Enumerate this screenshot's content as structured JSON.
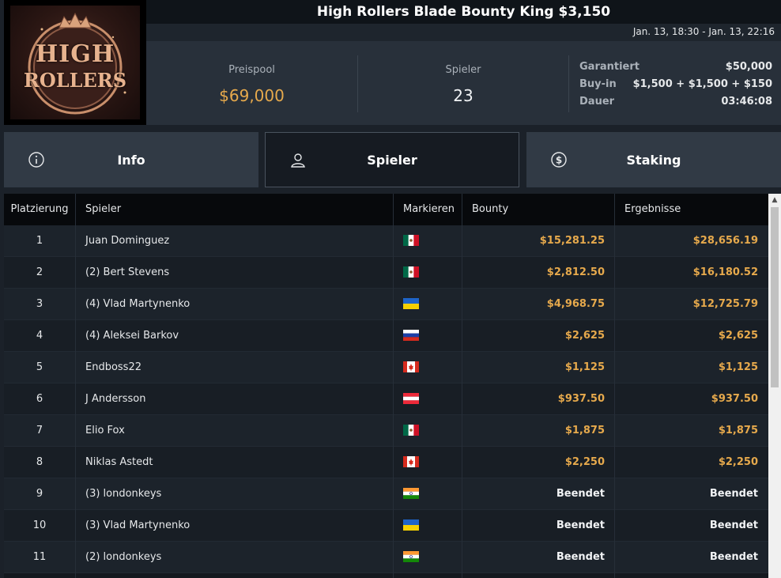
{
  "header": {
    "title": "High Rollers Blade Bounty King $3,150",
    "date_range": "Jan. 13, 18:30 - Jan. 13, 22:16",
    "logo_text_line1": "HIGH",
    "logo_text_line2": "ROLLERS"
  },
  "stats": {
    "prizepool_label": "Preispool",
    "prizepool_value": "$69,000",
    "players_label": "Spieler",
    "players_value": "23",
    "guaranteed_label": "Garantiert",
    "guaranteed_value": "$50,000",
    "buyin_label": "Buy-in",
    "buyin_value": "$1,500 + $1,500 + $150",
    "duration_label": "Dauer",
    "duration_value": "03:46:08"
  },
  "tabs": [
    {
      "label": "Info",
      "icon": "info-icon"
    },
    {
      "label": "Spieler",
      "icon": "user-icon"
    },
    {
      "label": "Staking",
      "icon": "dollar-coin-icon"
    }
  ],
  "table": {
    "headers": {
      "rank": "Platzierung",
      "player": "Spieler",
      "flag": "Markieren",
      "bounty": "Bounty",
      "result": "Ergebnisse"
    },
    "rows": [
      {
        "rank": "1",
        "player": "Juan Dominguez",
        "flag": "mexico",
        "bounty": "$15,281.25",
        "result": "$28,656.19"
      },
      {
        "rank": "2",
        "player": "(2) Bert Stevens",
        "flag": "mexico",
        "bounty": "$2,812.50",
        "result": "$16,180.52"
      },
      {
        "rank": "3",
        "player": "(4) Vlad Martynenko",
        "flag": "ukraine",
        "bounty": "$4,968.75",
        "result": "$12,725.79"
      },
      {
        "rank": "4",
        "player": "(4) Aleksei Barkov",
        "flag": "russia",
        "bounty": "$2,625",
        "result": "$2,625"
      },
      {
        "rank": "5",
        "player": "Endboss22",
        "flag": "canada",
        "bounty": "$1,125",
        "result": "$1,125"
      },
      {
        "rank": "6",
        "player": "J Andersson",
        "flag": "austria",
        "bounty": "$937.50",
        "result": "$937.50"
      },
      {
        "rank": "7",
        "player": "Elio Fox",
        "flag": "mexico",
        "bounty": "$1,875",
        "result": "$1,875"
      },
      {
        "rank": "8",
        "player": "Niklas Astedt",
        "flag": "canada",
        "bounty": "$2,250",
        "result": "$2,250"
      },
      {
        "rank": "9",
        "player": "(3) londonkeys",
        "flag": "india",
        "bounty": "Beendet",
        "result": "Beendet"
      },
      {
        "rank": "10",
        "player": "(3) Vlad Martynenko",
        "flag": "ukraine",
        "bounty": "Beendet",
        "result": "Beendet"
      },
      {
        "rank": "11",
        "player": "(2) londonkeys",
        "flag": "india",
        "bounty": "Beendet",
        "result": "Beendet"
      }
    ]
  },
  "colors": {
    "accent_gold": "#e6a94c",
    "background": "#1b2129"
  }
}
